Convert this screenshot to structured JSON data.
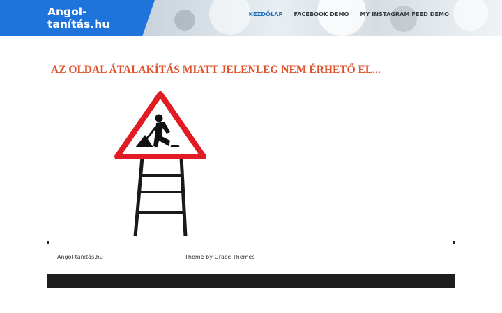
{
  "site": {
    "title": "Angol-tanítás.hu"
  },
  "nav": {
    "items": [
      {
        "label": "KEZDŐLAP",
        "active": true
      },
      {
        "label": "FACEBOOK DEMO",
        "active": false
      },
      {
        "label": "MY INSTAGRAM FEED DEMO",
        "active": false
      }
    ]
  },
  "main": {
    "notice": "AZ OLDAL ÁTALAKÍTÁS MIATT JELENLEG NEM ÉRHETŐ EL..."
  },
  "footer": {
    "site_name": "Angol-tanitás.hu",
    "credit": "Theme by Grace Themes"
  },
  "colors": {
    "brand": "#1f74dc",
    "nav_active": "#1f6fbf",
    "notice": "#e0502a",
    "sign_border": "#e01b24"
  }
}
